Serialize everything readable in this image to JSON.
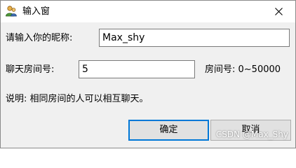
{
  "window": {
    "title": "输入窗",
    "app_icon": "user-icon",
    "close_icon": "close-icon"
  },
  "form": {
    "nickname_label": "请输入你的昵称:",
    "nickname_value": "Max_shy",
    "room_label": "聊天房间号:",
    "room_value": "5",
    "room_range_hint": "房间号: 0~50000",
    "description": "说明: 相同房间的人可以相互聊天。"
  },
  "buttons": {
    "ok_label": "确定",
    "cancel_label": "取消"
  },
  "watermark": "CSDN @Max_Shy",
  "colors": {
    "dialog_background": "#f0f0f0",
    "default_button_border": "#0078d7",
    "button_background": "#e1e1e1"
  }
}
